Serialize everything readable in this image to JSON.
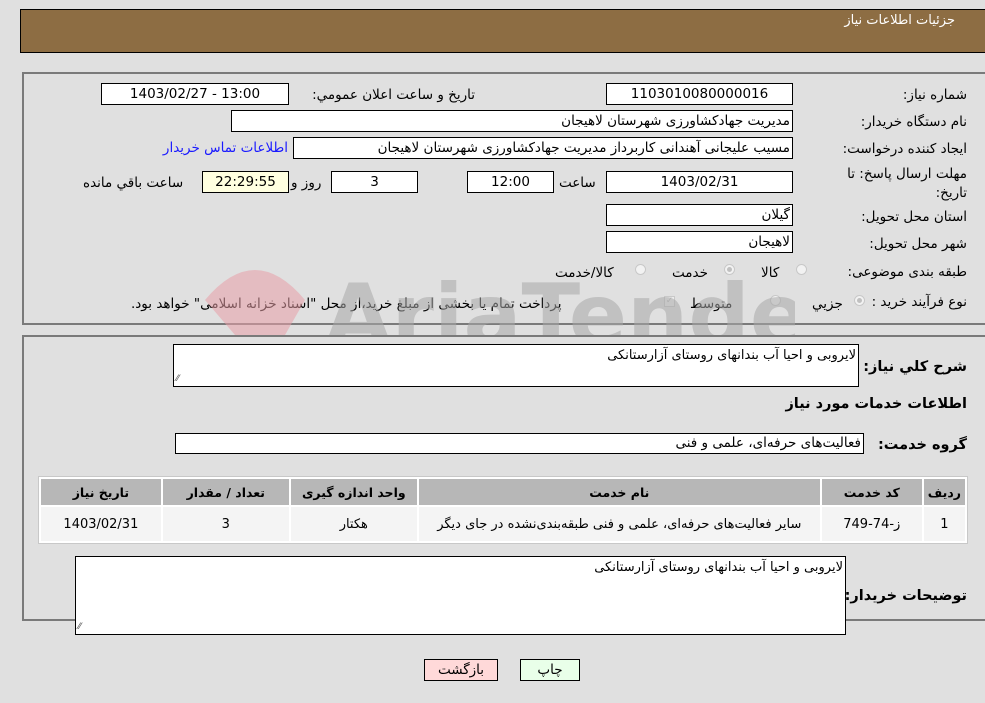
{
  "header": {
    "title": "جزئیات اطلاعات نیاز"
  },
  "details": {
    "need_number": {
      "label": "شماره نیاز:",
      "value": "1103010080000016"
    },
    "announce_datetime": {
      "label": "تاریخ و ساعت اعلان عمومي:",
      "value": "1403/02/27 - 13:00"
    },
    "buyer_org": {
      "label": "نام دستگاه خریدار:",
      "value": "مدیریت جهادکشاورزی شهرستان لاهیجان"
    },
    "requester": {
      "label": "ایجاد کننده درخواست:",
      "value": "مسیب علیجانی آهندانی کاربرداز مدیریت جهادکشاورزی شهرستان لاهیجان"
    },
    "buyer_contact_link": "اطلاعات تماس خریدار",
    "deadline": {
      "label": "مهلت ارسال پاسخ: تا تاریخ:",
      "date": "1403/02/31",
      "time_label": "ساعت",
      "time": "12:00",
      "days": "3",
      "days_label": "روز و",
      "remaining": "22:29:55",
      "remaining_label": "ساعت باقي مانده"
    },
    "delivery_province": {
      "label": "استان محل تحویل:",
      "value": "گیلان"
    },
    "delivery_city": {
      "label": "شهر محل تحویل:",
      "value": "لاهیجان"
    },
    "category": {
      "label": "طبقه بندی موضوعی:",
      "options": [
        "کالا",
        "خدمت",
        "کالا/خدمت"
      ],
      "selected": "خدمت"
    },
    "purchase_type": {
      "label": "نوع فرآیند خرید :",
      "options": [
        "جزيي",
        "متوسط"
      ],
      "selected": "جزيي",
      "treasury_note": "پرداخت تمام یا بخشی از مبلغ خرید،از محل \"اسناد خزانه اسلامی\" خواهد بود."
    }
  },
  "description": {
    "label": "شرح کلي نیاز:",
    "value": "لایروبی و احیا آب بندانهای روستای آزارستانکی"
  },
  "services": {
    "section_title": "اطلاعات خدمات مورد نیاز",
    "group_label": "گروه خدمت:",
    "group_value": "فعالیت‌های حرفه‌ای، علمی و فنی",
    "table": {
      "headers": [
        "ردیف",
        "کد خدمت",
        "نام خدمت",
        "واحد اندازه گیری",
        "تعداد / مقدار",
        "تاریخ نیاز"
      ],
      "rows": [
        [
          "1",
          "ز-74-749",
          "سایر فعالیت‌های حرفه‌ای، علمی و فنی طبقه‌بندی‌نشده در جای دیگر",
          "هکتار",
          "3",
          "1403/02/31"
        ]
      ]
    }
  },
  "buyer_notes": {
    "label": "توضیحات خریدار:",
    "value": "لایروبی و احیا آب بندانهای روستای آزارستانکی"
  },
  "buttons": {
    "print": "چاپ",
    "back": "بازگشت"
  },
  "watermark": {
    "text": "AriaTender.neT"
  }
}
